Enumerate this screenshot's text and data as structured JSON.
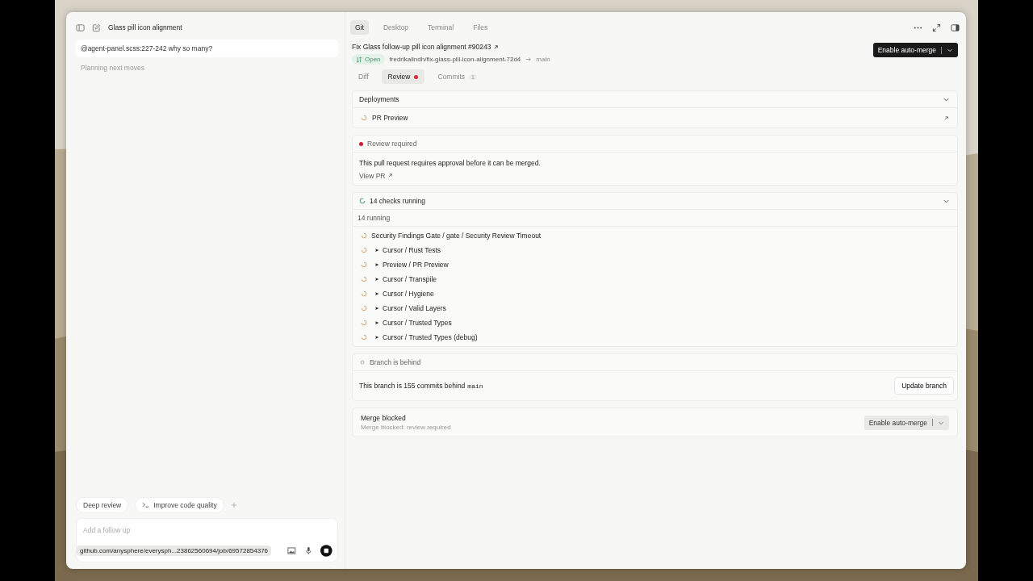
{
  "sidebar": {
    "title": "Glass pill icon alignment",
    "message": "@agent-panel.scss:227-242 why so many?",
    "status": "Planning next moves",
    "suggestions": [
      {
        "label": "Deep review",
        "kind": "plain"
      },
      {
        "label": "Improve code quality",
        "kind": "terminal"
      }
    ],
    "composer": {
      "placeholder": "Add a follow up"
    },
    "link_tooltip": "github.com/anysphere/everysph...23862560694/job/69572854376"
  },
  "top_tabs": [
    {
      "label": "Git",
      "selected": true
    },
    {
      "label": "Desktop",
      "selected": false
    },
    {
      "label": "Terminal",
      "selected": false
    },
    {
      "label": "Files",
      "selected": false
    }
  ],
  "pr": {
    "title": "Fix Glass follow-up pill icon alignment #90243",
    "state": "Open",
    "branch": "fredrikalindh/fix-glass-pill-icon-alignment-72d4",
    "base": "main",
    "merge_button": "Enable auto-merge"
  },
  "review_tabs": [
    {
      "label": "Diff",
      "selected": false,
      "alert": false
    },
    {
      "label": "Review",
      "selected": true,
      "alert": true
    },
    {
      "label": "Commits",
      "selected": false,
      "alert": false,
      "count": "1"
    }
  ],
  "deployments": {
    "title": "Deployments",
    "items": [
      "PR Preview"
    ]
  },
  "review": {
    "title": "Review required",
    "text": "This pull request requires approval before it can be merged.",
    "link": "View PR"
  },
  "checks": {
    "title": "14 checks running",
    "summary": "14 running",
    "items": [
      {
        "name": "Security Findings Gate / gate / Security Review Timeout",
        "expandable": false
      },
      {
        "name": "Cursor / Rust Tests",
        "expandable": true
      },
      {
        "name": "Preview / PR Preview",
        "expandable": true
      },
      {
        "name": "Cursor / Transpile",
        "expandable": true
      },
      {
        "name": "Cursor / Hygiene",
        "expandable": true
      },
      {
        "name": "Cursor / Valid Layers",
        "expandable": true
      },
      {
        "name": "Cursor / Trusted Types",
        "expandable": true
      },
      {
        "name": "Cursor / Trusted Types (debug)",
        "expandable": true
      }
    ]
  },
  "branch": {
    "title": "Branch is behind",
    "text": "This branch is 155 commits behind",
    "base": "main",
    "button": "Update branch"
  },
  "merge": {
    "title": "Merge blocked",
    "subtitle": "Merge blocked: review required",
    "button": "Enable auto-merge"
  }
}
